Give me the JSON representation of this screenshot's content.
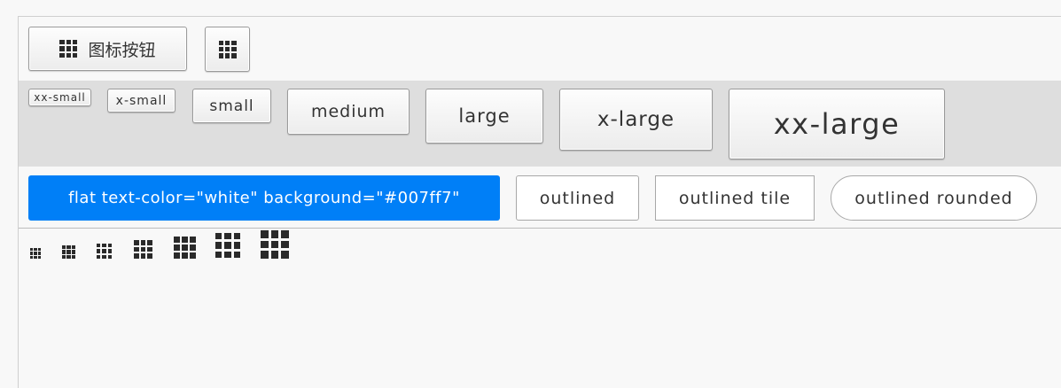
{
  "row1": {
    "icon_text_button": {
      "icon": "grid-icon",
      "label": "图标按钮"
    },
    "icon_only_button": {
      "icon": "grid-icon"
    }
  },
  "sizes": {
    "xx_small": "xx-small",
    "x_small": "x-small",
    "small": "small",
    "medium": "medium",
    "large": "large",
    "x_large": "x-large",
    "xx_large": "xx-large"
  },
  "row3": {
    "flat": {
      "label": "flat text-color=\"white\" background=\"#007ff7\"",
      "text_color": "#ffffff",
      "background": "#007ff7"
    },
    "outlined": "outlined",
    "outlined_tile": "outlined tile",
    "outlined_rounded": "outlined rounded"
  },
  "icons_row": {
    "icon": "grid-icon",
    "count": 7
  },
  "colors": {
    "page_bg": "#f8f8f8",
    "sizes_row_bg": "#dedede",
    "flat_bg": "#007ff7"
  }
}
